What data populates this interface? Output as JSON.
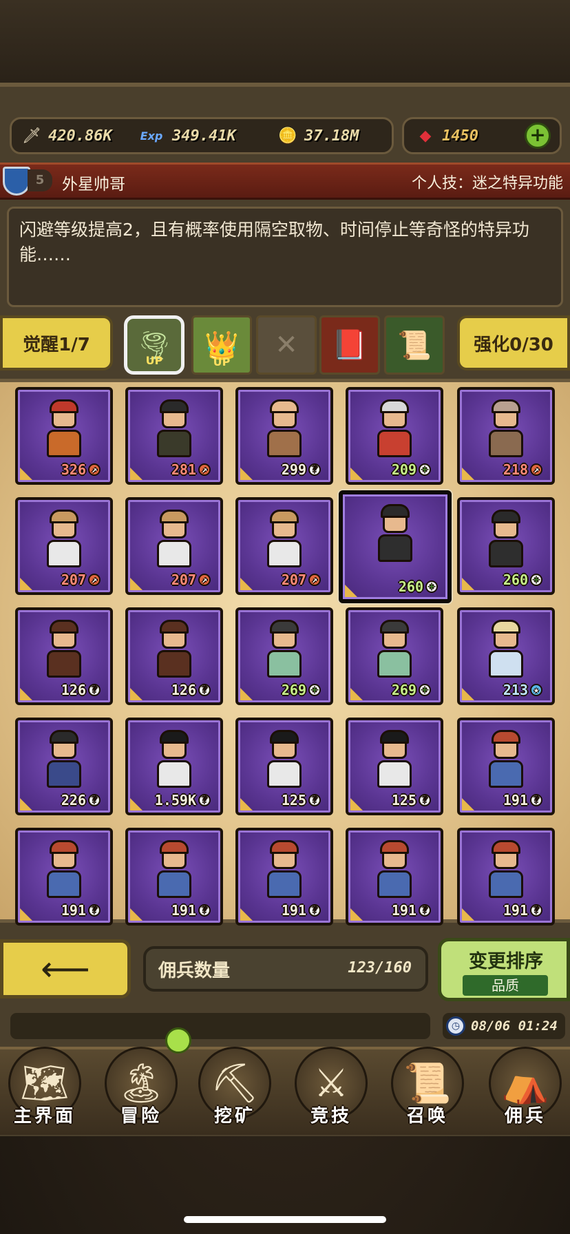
{
  "resources": {
    "attack": "420.86K",
    "exp_label": "Exp",
    "exp": "349.41K",
    "gold": "37.18M",
    "gems": "1450"
  },
  "hero": {
    "level": "5",
    "name": "外星帅哥",
    "skill": "个人技：迷之特异功能",
    "description": "闪避等级提高2，且有概率使用隔空取物、时间停止等奇怪的特异功能……"
  },
  "tabs": {
    "awaken": "觉醒1/7",
    "enhance": "强化0/30",
    "up_label": "UP"
  },
  "mercenaries": [
    {
      "value": "326",
      "icon": "sword",
      "hair": "#c0392b",
      "shirt": "#c96a2a"
    },
    {
      "value": "281",
      "icon": "sword",
      "hair": "#2a2a2a",
      "shirt": "#3a3a2a"
    },
    {
      "value": "299",
      "icon": "question",
      "hair": "#e7b98e",
      "shirt": "#a0704a"
    },
    {
      "value": "209",
      "icon": "plus",
      "hair": "#d8d8d8",
      "shirt": "#c84030"
    },
    {
      "value": "218",
      "icon": "sword",
      "hair": "#b8a090",
      "shirt": "#8a6a50"
    },
    {
      "value": "207",
      "icon": "sword",
      "hair": "#c89a60",
      "shirt": "#e8e8e8"
    },
    {
      "value": "207",
      "icon": "sword",
      "hair": "#c89a60",
      "shirt": "#e8e8e8"
    },
    {
      "value": "207",
      "icon": "sword",
      "hair": "#c89a60",
      "shirt": "#e8e8e8"
    },
    {
      "value": "260",
      "icon": "plus",
      "hair": "#2a2a2a",
      "shirt": "#2e2e2e"
    },
    {
      "value": "260",
      "icon": "plus",
      "hair": "#2a2a2a",
      "shirt": "#2e2e2e"
    },
    {
      "value": "126",
      "icon": "question",
      "hair": "#5a3020",
      "shirt": "#5a3020"
    },
    {
      "value": "126",
      "icon": "question",
      "hair": "#5a3020",
      "shirt": "#5a3020"
    },
    {
      "value": "269",
      "icon": "plus",
      "hair": "#3a3a3a",
      "shirt": "#8ac0a0"
    },
    {
      "value": "269",
      "icon": "plus",
      "hair": "#3a3a3a",
      "shirt": "#8ac0a0"
    },
    {
      "value": "213",
      "icon": "star",
      "hair": "#e8d8a0",
      "shirt": "#cfe0f0"
    },
    {
      "value": "226",
      "icon": "question",
      "hair": "#2a2a2a",
      "shirt": "#3a4a8a"
    },
    {
      "value": "1.59K",
      "icon": "question",
      "hair": "#1a1a1a",
      "shirt": "#e8e8e8"
    },
    {
      "value": "125",
      "icon": "question",
      "hair": "#1a1a1a",
      "shirt": "#e8e8e8"
    },
    {
      "value": "125",
      "icon": "question",
      "hair": "#1a1a1a",
      "shirt": "#e8e8e8"
    },
    {
      "value": "191",
      "icon": "question",
      "hair": "#b84a30",
      "shirt": "#4a6ab0"
    },
    {
      "value": "191",
      "icon": "question",
      "hair": "#b84a30",
      "shirt": "#4a6ab0"
    },
    {
      "value": "191",
      "icon": "question",
      "hair": "#b84a30",
      "shirt": "#4a6ab0"
    },
    {
      "value": "191",
      "icon": "question",
      "hair": "#b84a30",
      "shirt": "#4a6ab0"
    },
    {
      "value": "191",
      "icon": "question",
      "hair": "#b84a30",
      "shirt": "#4a6ab0"
    },
    {
      "value": "191",
      "icon": "question",
      "hair": "#b84a30",
      "shirt": "#4a6ab0"
    }
  ],
  "footer": {
    "count_label": "佣兵数量",
    "count_value": "123/160",
    "sort_title": "变更排序",
    "sort_mode": "品质",
    "time": "08/06 01:24"
  },
  "nav": [
    "主界面",
    "冒险",
    "挖矿",
    "竞技",
    "召唤",
    "佣兵"
  ],
  "colors": {
    "card_purple": "#5a3592",
    "button_yellow": "#e6cd4a",
    "sort_green": "#c0e07a",
    "name_bar_red": "#7a2a1a"
  }
}
